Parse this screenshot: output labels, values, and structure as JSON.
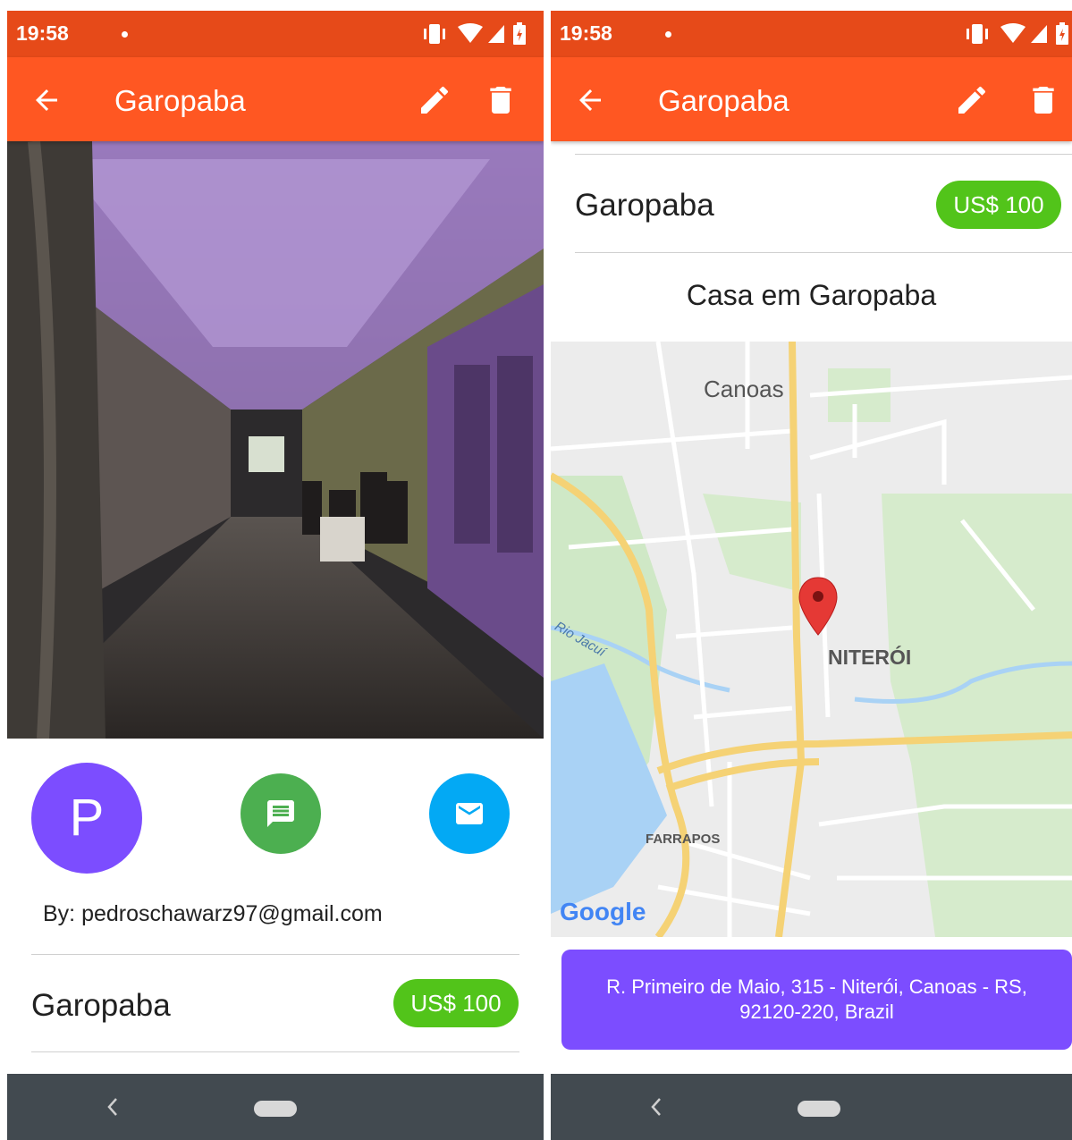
{
  "status": {
    "time": "19:58"
  },
  "app_bar": {
    "title": "Garopaba"
  },
  "listing": {
    "owner_initial": "P",
    "by_line": "By: pedroschawarz97@gmail.com",
    "name": "Garopaba",
    "price": "US$ 100",
    "subtitle": "Casa em Garopaba",
    "address": "R. Primeiro de Maio, 315 - Niterói, Canoas - RS, 92120-220, Brazil"
  },
  "map": {
    "labels": {
      "canoas": "Canoas",
      "niteroi": "NITERÓI",
      "farrapos": "FARRAPOS",
      "river": "Rio Jacuí"
    },
    "logo": "Google"
  },
  "colors": {
    "status_bar": "#E64A19",
    "app_bar": "#FF5722",
    "price_chip": "#52C41A",
    "avatar": "#7C4DFF",
    "message_fab": "#4CAF50",
    "mail_fab": "#03A9F4",
    "address_button": "#7C4DFF",
    "nav_bar": "#424a50"
  },
  "icons": {
    "back": "arrow-left-icon",
    "edit": "pencil-icon",
    "delete": "trash-icon",
    "message": "message-icon",
    "mail": "mail-icon",
    "pin": "map-pin-icon"
  }
}
